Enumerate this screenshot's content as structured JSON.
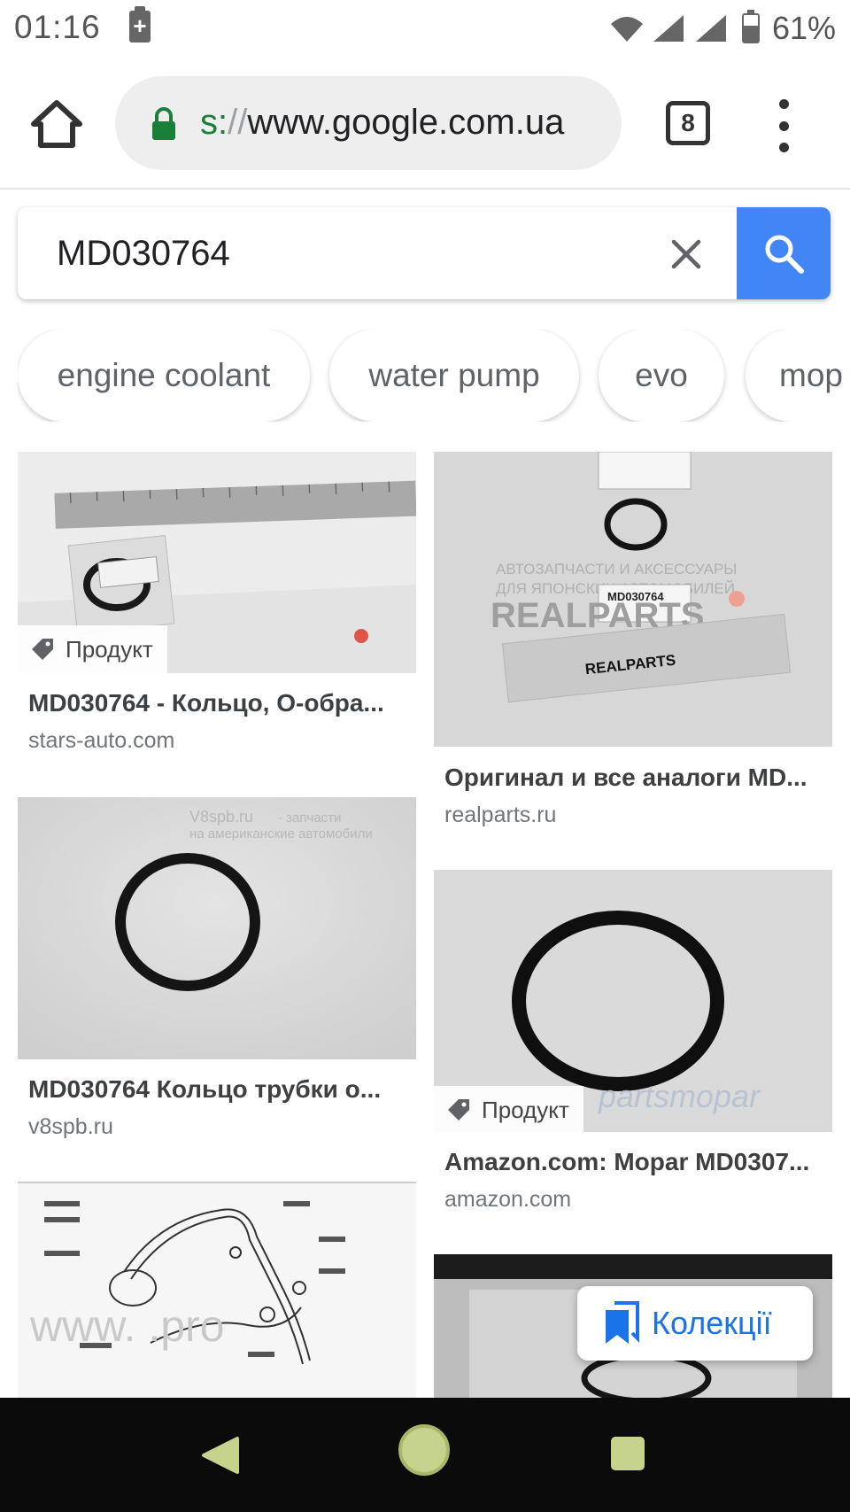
{
  "status_bar": {
    "time": "01:16",
    "battery_percent": "61%",
    "battery_level": 0.61
  },
  "browser": {
    "url_scheme": "s:",
    "url_sep": "//",
    "url_host": "www.google.com.ua",
    "tab_count": "8"
  },
  "search": {
    "query": "MD030764"
  },
  "chips": [
    "engine coolant",
    "water pump",
    "evo",
    "mop"
  ],
  "results": [
    {
      "title": "MD030764 - Кольцо, О-обра...",
      "source": "stars-auto.com",
      "badge": "Продукт"
    },
    {
      "title": "Оригинал и все аналоги MD...",
      "source": "realparts.ru",
      "badge": ""
    },
    {
      "title": "MD030764 Кольцо трубки о...",
      "source": "v8spb.ru",
      "badge": ""
    },
    {
      "title": "Amazon.com: Mopar MD0307...",
      "source": "amazon.com",
      "badge": "Продукт"
    }
  ],
  "image_text": {
    "realparts_tag": "MD030764",
    "realparts_wm_1": "АВТОЗАПЧАСТИ И АКСЕССУАРЫ",
    "realparts_wm_2": "ДЛЯ ЯПОНСКИХ АВТОМОБИЛЕЙ",
    "realparts_logo": "REALPARTS",
    "v8spb_wm": "V8spb.ru",
    "v8spb_wm_1": "- запчасти",
    "v8spb_wm_2": "на американские автомобили",
    "mopar_wm": "partsmopar",
    "diagram_wm": "www.          .pro"
  },
  "fab": {
    "label": "Колекції"
  },
  "colors": {
    "accent": "#4285f4",
    "link": "#1a73e8",
    "secure": "#188038",
    "nav_key": "#c6d38c"
  }
}
